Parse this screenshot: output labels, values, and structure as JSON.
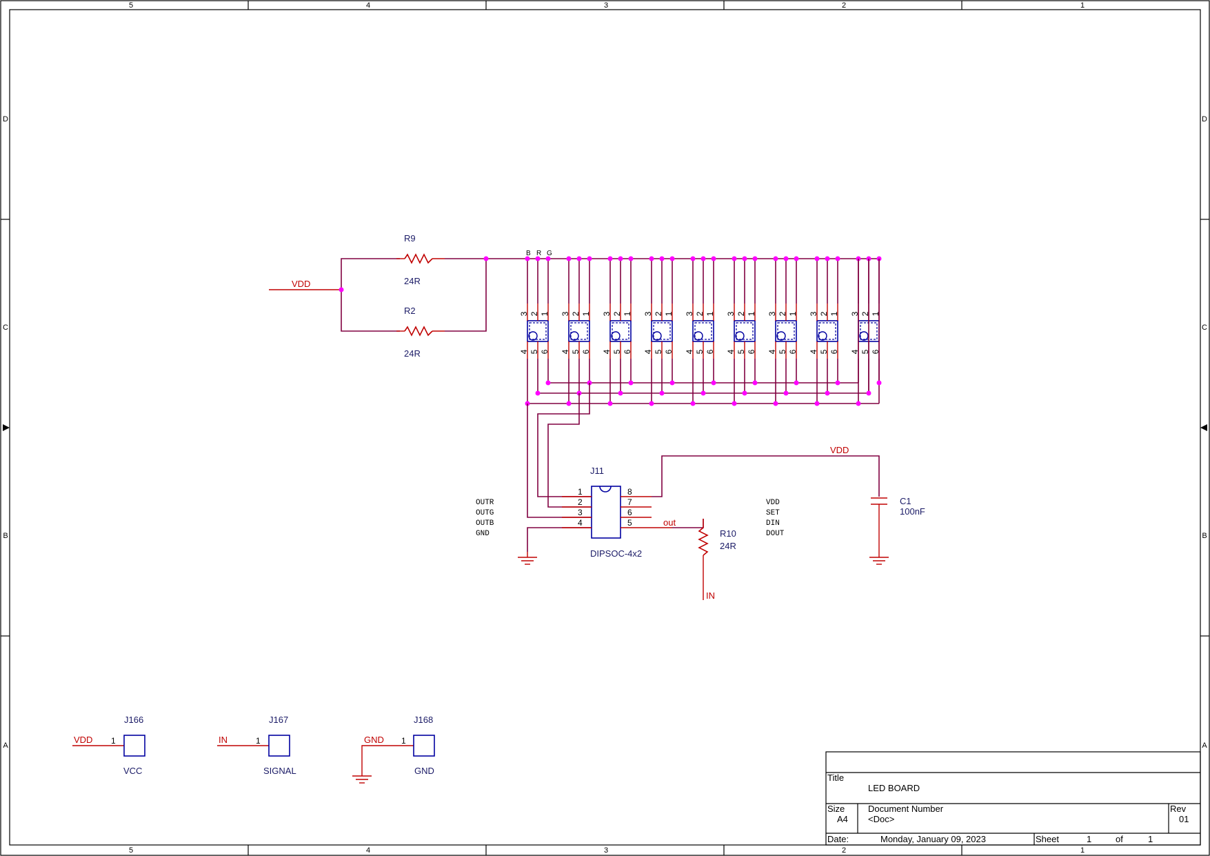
{
  "border": {
    "columns": [
      "5",
      "4",
      "3",
      "2",
      "1"
    ],
    "rows": [
      "D",
      "C",
      "B",
      "A"
    ]
  },
  "colors": {
    "wire": "#800040",
    "pin": "#c00000",
    "component_body": "#0000a0",
    "junction": "#ff00ff",
    "net_label": "#c00000",
    "ref_text": "#1a1a66"
  },
  "resistors": [
    {
      "ref": "R9",
      "value": "24R"
    },
    {
      "ref": "R2",
      "value": "24R"
    },
    {
      "ref": "R10",
      "value": "24R"
    }
  ],
  "capacitor": {
    "ref": "C1",
    "value": "100nF"
  },
  "nets": {
    "vdd": "VDD",
    "in": "IN",
    "gnd": "GND",
    "out": "out"
  },
  "led_top_labels": [
    "B",
    "R",
    "G"
  ],
  "led_pins_top": [
    "3",
    "2",
    "1"
  ],
  "led_pins_bottom": [
    "4",
    "5",
    "6"
  ],
  "ic": {
    "ref": "J11",
    "footprint": "DIPSOC-4x2",
    "left_pins": [
      "1",
      "2",
      "3",
      "4"
    ],
    "right_pins": [
      "8",
      "7",
      "6",
      "5"
    ],
    "left_signals": [
      "OUTR",
      "OUTG",
      "OUTB",
      "GND"
    ],
    "right_signals": [
      "VDD",
      "SET",
      "DIN",
      "DOUT"
    ]
  },
  "connectors": [
    {
      "ref": "J166",
      "net": "VDD",
      "pin": "1",
      "value": "VCC"
    },
    {
      "ref": "J167",
      "net": "IN",
      "pin": "1",
      "value": "SIGNAL"
    },
    {
      "ref": "J168",
      "net": "GND",
      "pin": "1",
      "value": "GND"
    }
  ],
  "title_block": {
    "title_label": "Title",
    "title": "LED BOARD",
    "size_label": "Size",
    "size": "A4",
    "doc_label": "Document Number",
    "doc": "<Doc>",
    "rev_label": "Rev",
    "rev": "01",
    "date_label": "Date:",
    "date": "Monday, January 09, 2023",
    "sheet_label": "Sheet",
    "sheet": "1",
    "of_label": "of",
    "of": "1"
  }
}
